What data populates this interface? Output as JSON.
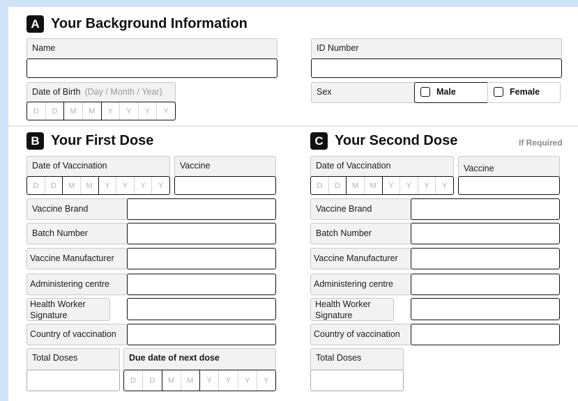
{
  "sectionA": {
    "badge": "A",
    "title": "Your Background Information",
    "name_label": "Name",
    "id_label": "ID Number",
    "dob_label": "Date of Birth",
    "dob_hint": "(Day / Month / Year)",
    "sex_label": "Sex",
    "sex_options": [
      "Male",
      "Female"
    ]
  },
  "date_placeholders": [
    "D",
    "D",
    "M",
    "M",
    "Y",
    "Y",
    "Y",
    "Y"
  ],
  "sectionB": {
    "badge": "B",
    "title": "Your First Dose",
    "date_label": "Date of Vaccination",
    "vaccine_label": "Vaccine",
    "rows": [
      "Vaccine Brand",
      "Batch Number",
      "Vaccine Manufacturer",
      "Administering centre",
      "Health Worker Signature",
      "Country of vaccination"
    ],
    "total_doses_label": "Total Doses",
    "next_dose_label": "Due date of next dose"
  },
  "sectionC": {
    "badge": "C",
    "title": "Your Second Dose",
    "if_required": "If Required",
    "date_label": "Date of Vaccination",
    "vaccine_label": "Vaccine",
    "rows": [
      "Vaccine Brand",
      "Batch Number",
      "Vaccine Manufacturer",
      "Administering centre",
      "Health Worker Signature",
      "Country of vaccination"
    ],
    "total_doses_label": "Total Doses"
  }
}
